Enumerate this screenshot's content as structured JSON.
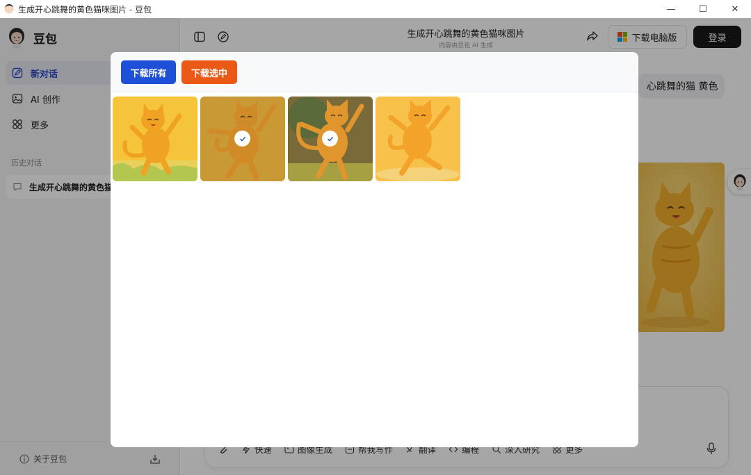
{
  "window": {
    "title": "生成开心跳舞的黄色猫咪图片 - 豆包",
    "controls": {
      "minimize": "—",
      "maximize": "☐",
      "close": "✕"
    }
  },
  "sidebar": {
    "brand": "豆包",
    "nav": [
      {
        "label": "新对话",
        "icon": "new-chat-icon",
        "active": true
      },
      {
        "label": "AI 创作",
        "icon": "image-icon",
        "active": false
      },
      {
        "label": "更多",
        "icon": "grid-icon",
        "active": false
      }
    ],
    "history_label": "历史对话",
    "history": [
      {
        "label": "生成开心跳舞的黄色猫咪图片"
      }
    ],
    "footer": {
      "about": "关于豆包"
    }
  },
  "header": {
    "chat_title": "生成开心跳舞的黄色猫咪图片",
    "chat_subtitle": "内容由豆包 AI 生成",
    "download_pc": "下载电脑版",
    "login": "登录"
  },
  "conversation": {
    "user_message": "心跳舞的猫 黄色"
  },
  "composer": {
    "tools": [
      {
        "label": "快速",
        "icon": "lightning-icon"
      },
      {
        "label": "图像生成",
        "icon": "image-gen-icon"
      },
      {
        "label": "帮我写作",
        "icon": "write-icon"
      },
      {
        "label": "翻译",
        "icon": "translate-icon"
      },
      {
        "label": "编程",
        "icon": "code-icon"
      },
      {
        "label": "深入研究",
        "icon": "research-icon"
      },
      {
        "label": "更多",
        "icon": "more-grid-icon"
      }
    ]
  },
  "modal": {
    "download_all": "下载所有",
    "download_selected": "下载选中",
    "images": [
      {
        "selected": false
      },
      {
        "selected": true
      },
      {
        "selected": true
      },
      {
        "selected": false
      }
    ]
  },
  "colors": {
    "primary_blue": "#1d4fd8",
    "orange": "#ea5a16",
    "cat_yellow": "#f5b82e"
  }
}
